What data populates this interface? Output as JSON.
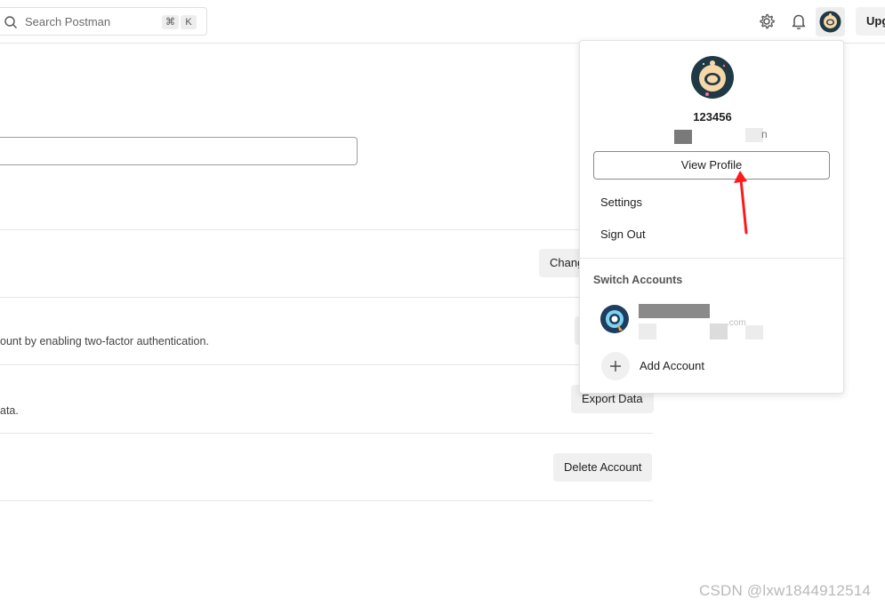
{
  "header": {
    "search_placeholder": "Search Postman",
    "shortcut_keys": [
      "⌘",
      "K"
    ],
    "upgrade_label": "Upg",
    "icons": [
      "search-icon",
      "settings-gear-icon",
      "notification-bell-icon",
      "user-avatar"
    ]
  },
  "main": {
    "rows": [
      {
        "description": "",
        "button_label": "Chang"
      },
      {
        "description": "ount by enabling two-factor authentication.",
        "button_label": ""
      },
      {
        "description": "ata.",
        "button_label": "Export Data"
      },
      {
        "description": "",
        "button_label": "Delete Account"
      }
    ]
  },
  "profile_menu": {
    "username": "123456",
    "email_fragment": "n",
    "view_profile_label": "View Profile",
    "items": [
      "Settings",
      "Sign Out"
    ],
    "switch_accounts_heading": "Switch Accounts",
    "other_account_fragment": ".com",
    "add_account_label": "Add Account"
  },
  "watermark": "CSDN @lxw1844912514",
  "colors": {
    "annotation_arrow": "#ff1a1a",
    "avatar_dark": "#1f3a45",
    "avatar_face": "#f6d7a8"
  }
}
